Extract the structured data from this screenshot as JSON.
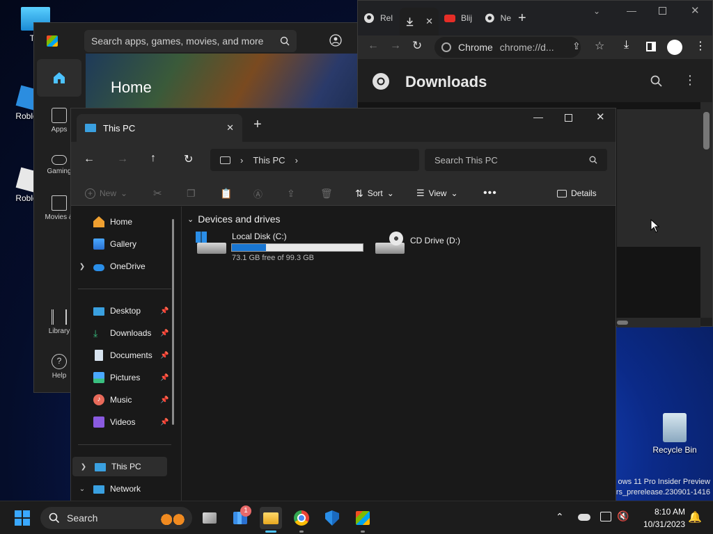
{
  "desktop": {
    "icons": [
      {
        "label": "Thi"
      },
      {
        "label": "Roblox"
      },
      {
        "label": "Roblox"
      },
      {
        "label": "Recycle Bin"
      }
    ],
    "watermark_line1": "ows 11 Pro Insider Preview",
    "watermark_line2": "rs_prerelease.230901-1416"
  },
  "store": {
    "search_placeholder": "Search apps, games, movies, and more",
    "hero_title": "Home",
    "rail": [
      {
        "label": ""
      },
      {
        "label": "Apps"
      },
      {
        "label": "Gaming"
      },
      {
        "label": "Movies &"
      },
      {
        "label": "Library"
      },
      {
        "label": "Help"
      }
    ]
  },
  "chrome": {
    "tabs": [
      {
        "label": "Rel"
      },
      {
        "label": ""
      },
      {
        "label": "Blij"
      },
      {
        "label": "Ne"
      }
    ],
    "omnibox_scheme": "Chrome",
    "omnibox_url": "chrome://d...",
    "page_title": "Downloads"
  },
  "explorer": {
    "tab_title": "This PC",
    "breadcrumb": "This PC",
    "search_placeholder": "Search This PC",
    "toolbar": {
      "new": "New",
      "sort": "Sort",
      "view": "View",
      "details": "Details"
    },
    "sidebar": [
      {
        "label": "Home",
        "pinned": false
      },
      {
        "label": "Gallery",
        "pinned": false
      },
      {
        "label": "OneDrive",
        "pinned": false
      },
      {
        "label": "Desktop",
        "pinned": true
      },
      {
        "label": "Downloads",
        "pinned": true
      },
      {
        "label": "Documents",
        "pinned": true
      },
      {
        "label": "Pictures",
        "pinned": true
      },
      {
        "label": "Music",
        "pinned": true
      },
      {
        "label": "Videos",
        "pinned": true
      },
      {
        "label": "This PC",
        "pinned": false
      },
      {
        "label": "Network",
        "pinned": false
      }
    ],
    "section_title": "Devices and drives",
    "drives": [
      {
        "name": "Local Disk (C:)",
        "free_text": "73.1 GB free of 99.3 GB",
        "used_fraction": 0.26
      },
      {
        "name": "CD Drive (D:)"
      }
    ]
  },
  "taskbar": {
    "search_label": "Search",
    "badge_count": "1",
    "time": "8:10 AM",
    "date": "10/31/2023"
  }
}
